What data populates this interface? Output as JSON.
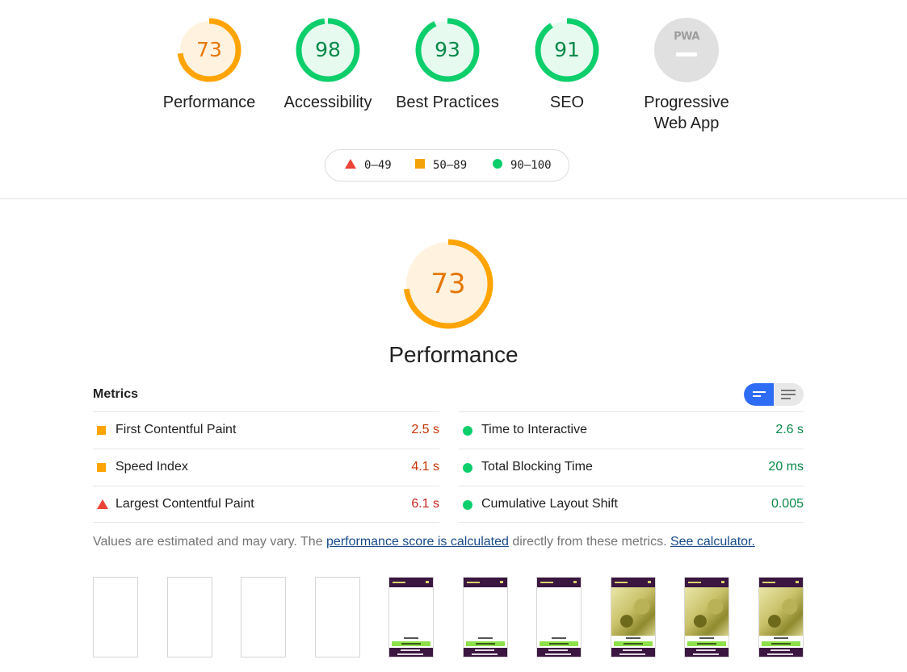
{
  "categories": [
    {
      "id": "performance",
      "score": "73",
      "label": "Performance",
      "color": "#ffa400",
      "text_color": "#e67700",
      "bg": "#fff3e0",
      "progress": 0.73
    },
    {
      "id": "accessibility",
      "score": "98",
      "label": "Accessibility",
      "color": "#0cce6b",
      "text_color": "#0a8a48",
      "bg": "#e6faf0",
      "progress": 0.98
    },
    {
      "id": "best-practices",
      "score": "93",
      "label": "Best Practices",
      "color": "#0cce6b",
      "text_color": "#0a8a48",
      "bg": "#e6faf0",
      "progress": 0.93
    },
    {
      "id": "seo",
      "score": "91",
      "label": "SEO",
      "color": "#0cce6b",
      "text_color": "#0a8a48",
      "bg": "#e6faf0",
      "progress": 0.91
    }
  ],
  "pwa": {
    "badge_text": "PWA",
    "label_line1": "Progressive",
    "label_line2": "Web App"
  },
  "legend": {
    "fail": "0–49",
    "average": "50–89",
    "pass": "90–100"
  },
  "performance": {
    "score": "73",
    "title": "Performance",
    "progress": 0.73
  },
  "metrics": {
    "header": "Metrics",
    "left": [
      {
        "name": "First Contentful Paint",
        "value": "2.5 s",
        "status": "average"
      },
      {
        "name": "Speed Index",
        "value": "4.1 s",
        "status": "average"
      },
      {
        "name": "Largest Contentful Paint",
        "value": "6.1 s",
        "status": "fail"
      }
    ],
    "right": [
      {
        "name": "Time to Interactive",
        "value": "2.6 s",
        "status": "pass"
      },
      {
        "name": "Total Blocking Time",
        "value": "20 ms",
        "status": "pass"
      },
      {
        "name": "Cumulative Layout Shift",
        "value": "0.005",
        "status": "pass"
      }
    ]
  },
  "note": {
    "prefix": "Values are estimated and may vary. The ",
    "link1": "performance score is calculated",
    "middle": " directly from these metrics. ",
    "link2": "See calculator."
  },
  "status_colors": {
    "pass": "#0cce6b",
    "average": "#ffa400",
    "fail": "#eb4335"
  },
  "value_colors": {
    "pass": "#0a8a48",
    "average": "#c33300",
    "fail": "#c7221f"
  },
  "filmstrip": [
    "blank",
    "blank",
    "blank",
    "blank",
    "text",
    "text",
    "text",
    "image",
    "image",
    "image"
  ]
}
